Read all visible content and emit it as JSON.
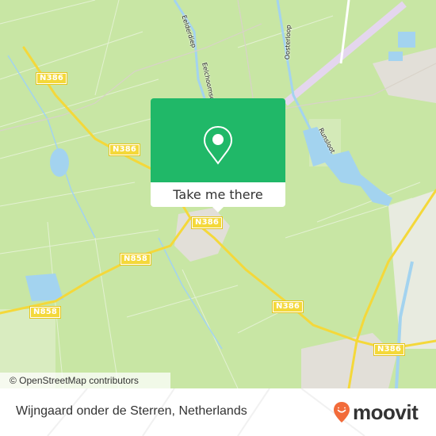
{
  "map": {
    "attribution": "© OpenStreetMap contributors",
    "road_labels": [
      {
        "id": "n386-a",
        "text": "N386"
      },
      {
        "id": "n386-b",
        "text": "N386"
      },
      {
        "id": "n386-c",
        "text": "N386"
      },
      {
        "id": "n386-d",
        "text": "N386"
      },
      {
        "id": "n386-e",
        "text": "N386"
      },
      {
        "id": "n858-a",
        "text": "N858"
      },
      {
        "id": "n858-b",
        "text": "N858"
      }
    ],
    "water_labels": [
      {
        "id": "eelderdiep",
        "text": "Eelderdiep"
      },
      {
        "id": "eelchoornse",
        "text": "Eelchoornse"
      },
      {
        "id": "oosterloop",
        "text": "Oosterloop"
      },
      {
        "id": "runsloot",
        "text": "Runsloot"
      }
    ],
    "colors": {
      "land": "#c8e6a4",
      "water": "#a3d3ef",
      "road": "#f4d83a",
      "urban": "#e5e1dc",
      "runway": "#e6d9ef"
    }
  },
  "popup": {
    "button_label": "Take me there",
    "icon": "map-pin-icon",
    "color": "#20b868"
  },
  "footer": {
    "place_name": "Wijngaard onder de Sterren, Netherlands",
    "brand": "moovit",
    "brand_color": "#f26b3a"
  }
}
